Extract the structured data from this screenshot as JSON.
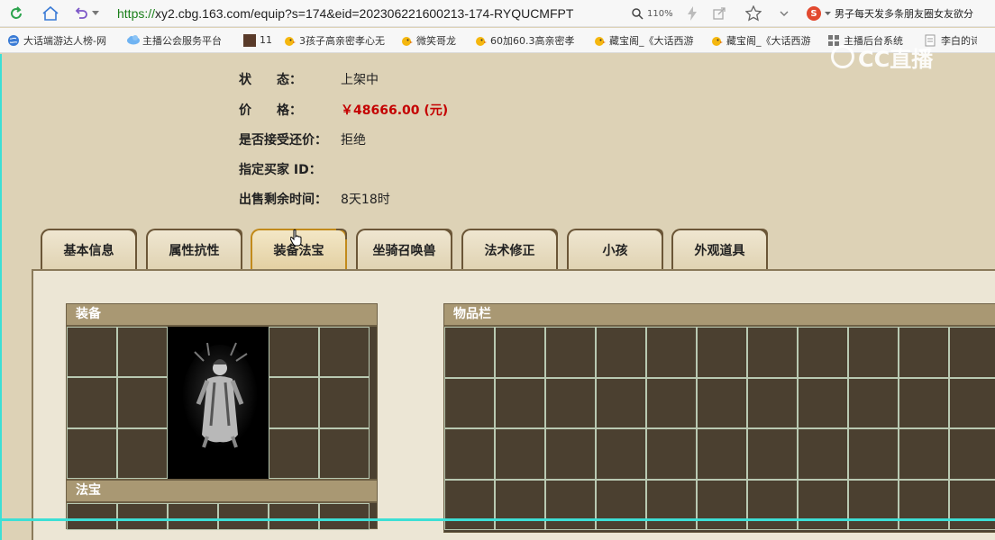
{
  "browser": {
    "url_secure": "https://",
    "url_rest": "xy2.cbg.163.com/equip?s=174&eid=202306221600213-174-RYQUCMFPT",
    "zoom": "110%",
    "search_text": "男子每天发多条朋友圈女友欲分"
  },
  "bookmarks": [
    {
      "label": "大话端游达人榜-网",
      "icon": "globe-blue"
    },
    {
      "label": "主播公会服务平台",
      "icon": "cloud"
    },
    {
      "label": "11",
      "icon": "image-thumb"
    },
    {
      "label": "3孩子高亲密孝心无",
      "icon": "chick"
    },
    {
      "label": "微笑哥龙",
      "icon": "chick"
    },
    {
      "label": "60加60.3高亲密孝",
      "icon": "chick"
    },
    {
      "label": "藏宝阁_《大话西游",
      "icon": "chick"
    },
    {
      "label": "藏宝阁_《大话西游",
      "icon": "chick"
    },
    {
      "label": "主播后台系统",
      "icon": "grid"
    },
    {
      "label": "李白的诗,",
      "icon": "doc"
    }
  ],
  "watermark": "CC直播",
  "info": {
    "rows": [
      {
        "label": "状　　态：",
        "value": "上架中",
        "style": "normal"
      },
      {
        "label": "价　　格：",
        "value": "￥48666.00 (元)",
        "style": "price"
      },
      {
        "label": "是否接受还价：",
        "value": "拒绝",
        "style": "normal"
      },
      {
        "label": "指定买家 ID：",
        "value": "",
        "style": "normal"
      },
      {
        "label": "出售剩余时间：",
        "value": "8天18时",
        "style": "normal"
      }
    ]
  },
  "tabs": [
    {
      "label": "基本信息",
      "active": false
    },
    {
      "label": "属性抗性",
      "active": false
    },
    {
      "label": "装备法宝",
      "active": true
    },
    {
      "label": "坐骑召唤兽",
      "active": false
    },
    {
      "label": "法术修正",
      "active": false
    },
    {
      "label": "小孩",
      "active": false
    },
    {
      "label": "外观道具",
      "active": false
    }
  ],
  "sections": {
    "equipment": "装备",
    "treasure": "法宝",
    "inventory": "物品栏"
  },
  "colors": {
    "accent_price": "#c40000",
    "page_bg": "#ddd2b6",
    "cell_bg": "#4b4030",
    "tab_active_border": "#c28a1b",
    "capture_frame": "#3ddfd5"
  }
}
